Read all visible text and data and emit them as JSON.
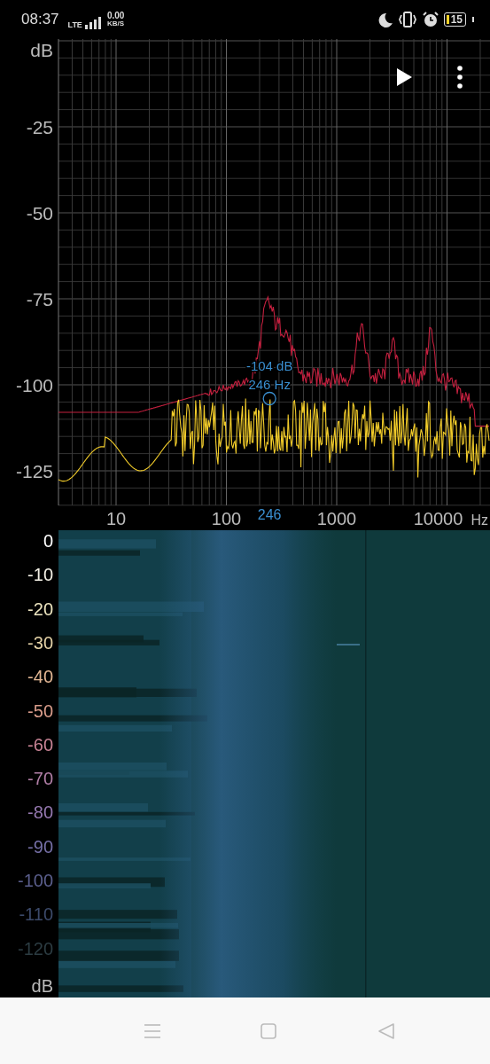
{
  "status_bar": {
    "time": "08:37",
    "network": "LTE",
    "speed_value": "0.00",
    "speed_unit": "KB/S",
    "battery": "15"
  },
  "toolbar": {
    "buttons": [
      {
        "kind": "play"
      },
      {
        "kind": "menu"
      }
    ]
  },
  "spectrum": {
    "y_unit": "dB",
    "y_labels": [
      "-25",
      "-50",
      "-75",
      "-100",
      "-125"
    ],
    "x_labels": [
      "10",
      "100",
      "1000",
      "10000"
    ],
    "x_unit": "Hz",
    "cursor": {
      "level_text": "-104 dB",
      "freq_text": "246 Hz",
      "axis_text": "246"
    }
  },
  "spectrogram": {
    "unit": "dB",
    "scale_labels": [
      {
        "text": "0",
        "color": "#ffffff"
      },
      {
        "text": "-10",
        "color": "#f4f1e6"
      },
      {
        "text": "-20",
        "color": "#ece4bf"
      },
      {
        "text": "-30",
        "color": "#e4d2a6"
      },
      {
        "text": "-40",
        "color": "#e3b794"
      },
      {
        "text": "-50",
        "color": "#d99c8a"
      },
      {
        "text": "-60",
        "color": "#c98496"
      },
      {
        "text": "-70",
        "color": "#b07ea6"
      },
      {
        "text": "-80",
        "color": "#9578b0"
      },
      {
        "text": "-90",
        "color": "#7670a8"
      },
      {
        "text": "-100",
        "color": "#5a5e8c"
      },
      {
        "text": "-110",
        "color": "#3c4a6a"
      },
      {
        "text": "-120",
        "color": "#2c3c42"
      }
    ]
  },
  "nav_bar": {
    "buttons": [
      {
        "kind": "recents"
      },
      {
        "kind": "home"
      },
      {
        "kind": "back"
      }
    ]
  }
}
